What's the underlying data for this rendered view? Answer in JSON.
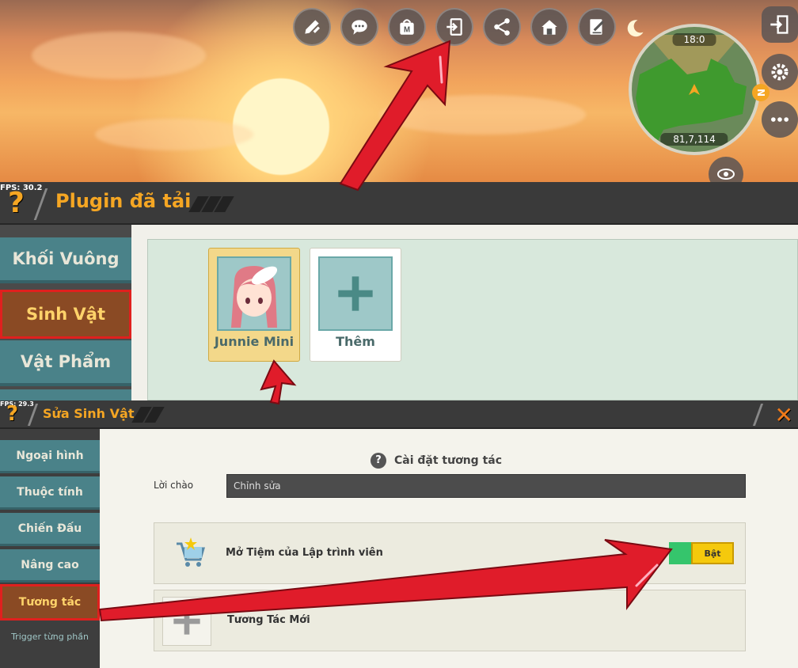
{
  "scene": {
    "time_label": "18:0",
    "coords_label": "81,7,114",
    "top_icons": [
      "pencil-ruler-icon",
      "chat-bubble-icon",
      "store-bag-icon",
      "import-icon",
      "share-icon",
      "home-icon",
      "edit-note-icon"
    ],
    "right_buttons": [
      "exit-icon",
      "gear-icon",
      "more-icon"
    ],
    "compass_label": "N"
  },
  "plugin_bar": {
    "fps": "FPS: 30.2",
    "title": "Plugin đã tải"
  },
  "plugin_sidebar": {
    "items": [
      {
        "label": "Khối Vuông",
        "active": false
      },
      {
        "label": "Sinh Vật",
        "active": true
      },
      {
        "label": "Vật Phẩm",
        "active": false
      }
    ]
  },
  "plugin_cards": [
    {
      "label": "Junnie Mini",
      "kind": "character"
    },
    {
      "label": "Thêm",
      "kind": "add"
    }
  ],
  "edit_bar": {
    "fps": "FPS: 29.3",
    "title": "Sửa Sinh Vật",
    "close": "✕"
  },
  "edit_sidebar": {
    "items": [
      {
        "label": "Ngoại hình",
        "active": false
      },
      {
        "label": "Thuộc tính",
        "active": false
      },
      {
        "label": "Chiến Đấu",
        "active": false
      },
      {
        "label": "Nâng cao",
        "active": false
      },
      {
        "label": "Tương tác",
        "active": true
      }
    ],
    "link": "Trigger từng phần"
  },
  "interaction": {
    "section_title": "Cài đặt tương tác",
    "help": "?",
    "greeting_label": "Lời chào",
    "greeting_value": "Chỉnh sửa",
    "shop_label": "Mở Tiệm của Lập trình viên",
    "shop_toggle": "Bật",
    "new_label": "Tương Tác Mới"
  },
  "colors": {
    "accent": "#f5a623",
    "teal": "#4a8289",
    "active": "#8a4a24",
    "highlight": "#e0201e",
    "toggle_on": "#35c56c",
    "toggle_btn": "#f5c90c"
  }
}
